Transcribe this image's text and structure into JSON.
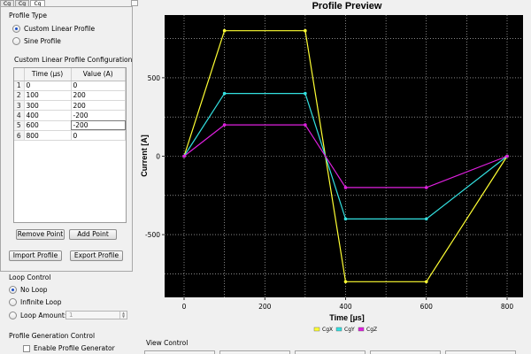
{
  "tabs": [
    {
      "label": "Cg",
      "active": false
    },
    {
      "label": "Cg",
      "active": false
    },
    {
      "label": "Cg",
      "active": true
    }
  ],
  "profile_type": {
    "title": "Profile Type",
    "options": [
      {
        "label": "Custom Linear Profile",
        "selected": true
      },
      {
        "label": "Sine Profile",
        "selected": false
      }
    ]
  },
  "custom_profile": {
    "title": "Custom Linear Profile Configuration",
    "columns": [
      "Time (µs)",
      "Value (A)"
    ],
    "rows": [
      {
        "index": "1",
        "time": "0",
        "value": "0"
      },
      {
        "index": "2",
        "time": "100",
        "value": "200"
      },
      {
        "index": "3",
        "time": "300",
        "value": "200"
      },
      {
        "index": "4",
        "time": "400",
        "value": "-200"
      },
      {
        "index": "5",
        "time": "600",
        "value": "-200"
      },
      {
        "index": "6",
        "time": "800",
        "value": "0"
      }
    ],
    "remove_label": "Remove Point",
    "add_label": "Add Point",
    "import_label": "Import Profile",
    "export_label": "Export Profile"
  },
  "loop_control": {
    "title": "Loop Control",
    "options": [
      {
        "label": "No Loop",
        "selected": true
      },
      {
        "label": "Infinite Loop",
        "selected": false
      },
      {
        "label": "Loop Amount:",
        "selected": false
      }
    ],
    "amount_value": "1"
  },
  "generation": {
    "title": "Profile Generation Control",
    "enable_label": "Enable Profile Generator",
    "enabled": false
  },
  "view_control": {
    "title": "View Control"
  },
  "chart_data": {
    "type": "line",
    "title": "Profile Preview",
    "xlabel": "Time [µs]",
    "ylabel": "Current [A]",
    "xlim": [
      0,
      800
    ],
    "ylim": [
      -900,
      900
    ],
    "xticks": [
      0,
      200,
      400,
      600,
      800
    ],
    "yticks": [
      -500,
      0,
      500
    ],
    "grid": true,
    "background": "#000000",
    "legend_position": "bottom-center",
    "series": [
      {
        "name": "CgX",
        "color": "#ffff33",
        "x": [
          0,
          100,
          300,
          400,
          600,
          800
        ],
        "y": [
          0,
          800,
          800,
          -800,
          -800,
          0
        ]
      },
      {
        "name": "CgY",
        "color": "#33e0e0",
        "x": [
          0,
          100,
          300,
          400,
          600,
          800
        ],
        "y": [
          0,
          400,
          400,
          -400,
          -400,
          0
        ]
      },
      {
        "name": "CgZ",
        "color": "#e020e0",
        "x": [
          0,
          100,
          300,
          400,
          600,
          800
        ],
        "y": [
          0,
          200,
          200,
          -200,
          -200,
          0
        ]
      }
    ]
  }
}
